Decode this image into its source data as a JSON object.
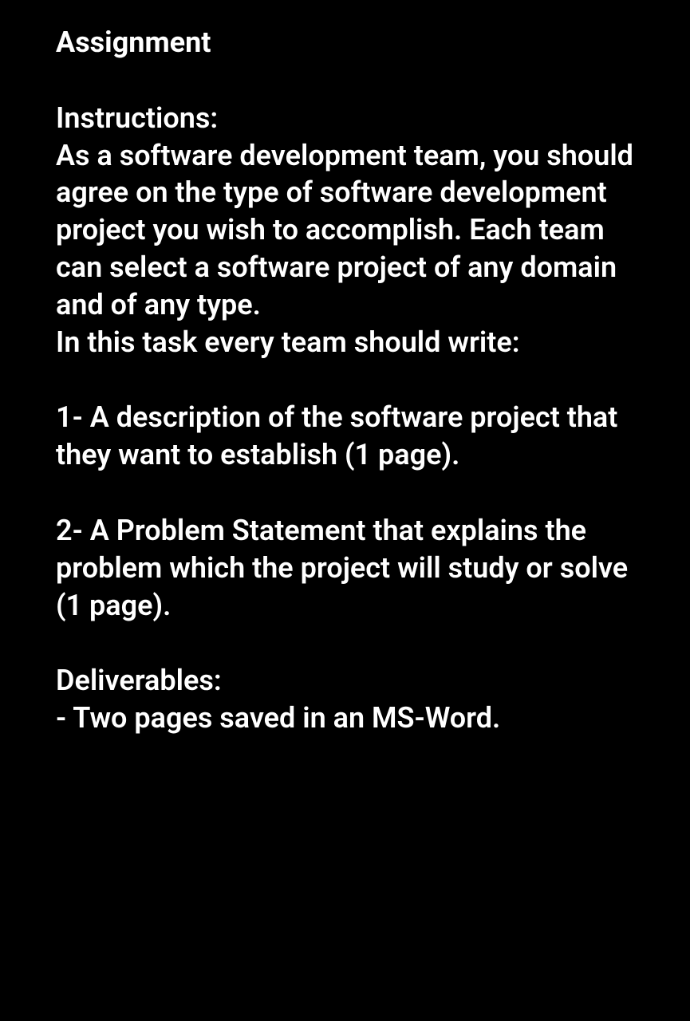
{
  "title": "Assignment",
  "instructions": {
    "heading": "Instructions:",
    "body1": "As a software development team, you should agree on the type of software development project you wish to accomplish. Each team can select a software project of any domain and of any type.",
    "body2": "In this task every team should write:"
  },
  "item1": "1- A description of the software project that they want to establish (1 page).",
  "item2": "2- A Problem Statement that explains the problem which the project will study or solve (1 page).",
  "deliverables": {
    "heading": "Deliverables:",
    "body": "- Two pages saved in an MS-Word."
  }
}
